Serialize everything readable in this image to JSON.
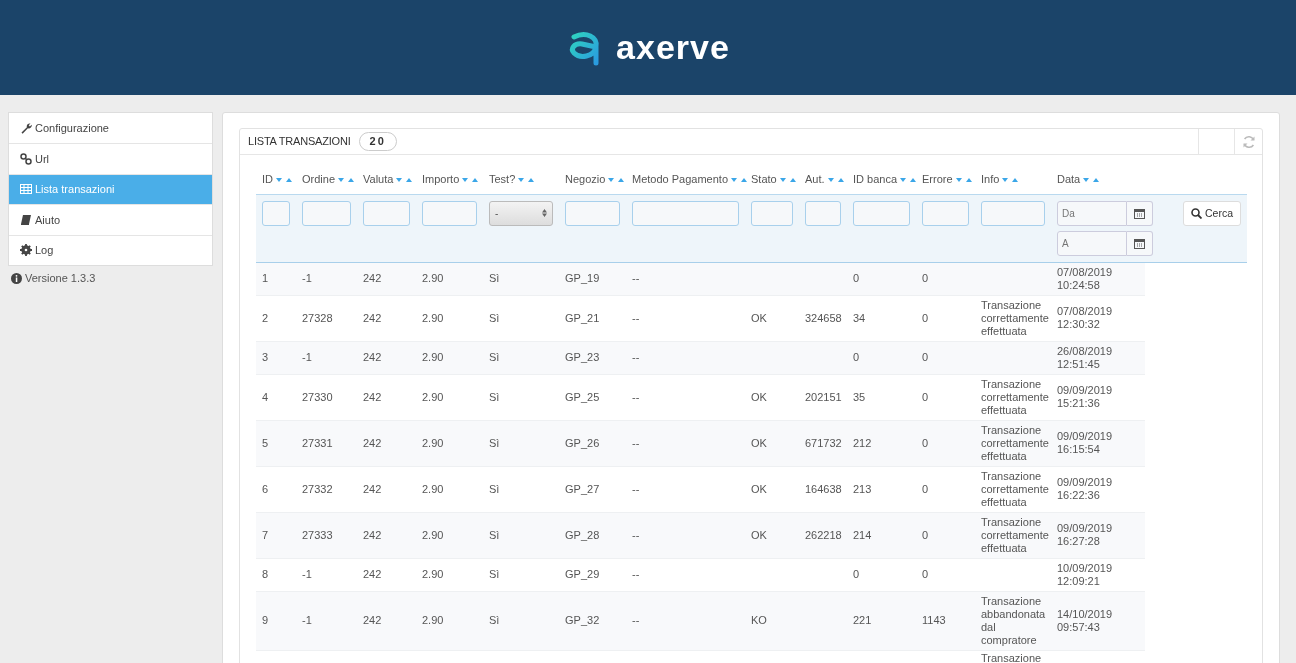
{
  "header": {
    "logo_text": "axerve"
  },
  "sidebar": {
    "items": [
      {
        "label": "Configurazione",
        "selected": false
      },
      {
        "label": "Url",
        "selected": false
      },
      {
        "label": "Lista transazioni",
        "selected": true
      },
      {
        "label": "Aiuto",
        "selected": false
      },
      {
        "label": "Log",
        "selected": false
      }
    ],
    "version": "Versione 1.3.3"
  },
  "panel": {
    "title": "LISTA TRANSAZIONI",
    "count": "20"
  },
  "table": {
    "columns": [
      "ID",
      "Ordine",
      "Valuta",
      "Importo",
      "Test?",
      "Negozio",
      "Metodo Pagamento",
      "Stato",
      "Aut.",
      "ID banca",
      "Errore",
      "Info",
      "Data"
    ],
    "filters": [
      {
        "kind": "input"
      },
      {
        "kind": "input"
      },
      {
        "kind": "input"
      },
      {
        "kind": "input"
      },
      {
        "kind": "select",
        "value": "-"
      },
      {
        "kind": "input"
      },
      {
        "kind": "input"
      },
      {
        "kind": "input"
      },
      {
        "kind": "input"
      },
      {
        "kind": "input"
      },
      {
        "kind": "input"
      },
      {
        "kind": "input"
      },
      {
        "kind": "date",
        "placeholders": [
          "Da",
          "A"
        ]
      }
    ],
    "search_button": "Cerca",
    "rows": [
      [
        "1",
        "-1",
        "242",
        "2.90",
        "Sì",
        "GP_19",
        "--",
        null,
        null,
        "0",
        "0",
        null,
        "07/08/2019 10:24:58"
      ],
      [
        "2",
        "27328",
        "242",
        "2.90",
        "Sì",
        "GP_21",
        "--",
        "OK",
        "324658",
        "34",
        "0",
        "Transazione correttamente effettuata",
        "07/08/2019 12:30:32"
      ],
      [
        "3",
        "-1",
        "242",
        "2.90",
        "Sì",
        "GP_23",
        "--",
        null,
        null,
        "0",
        "0",
        null,
        "26/08/2019 12:51:45"
      ],
      [
        "4",
        "27330",
        "242",
        "2.90",
        "Sì",
        "GP_25",
        "--",
        "OK",
        "202151",
        "35",
        "0",
        "Transazione correttamente effettuata",
        "09/09/2019 15:21:36"
      ],
      [
        "5",
        "27331",
        "242",
        "2.90",
        "Sì",
        "GP_26",
        "--",
        "OK",
        "671732",
        "212",
        "0",
        "Transazione correttamente effettuata",
        "09/09/2019 16:15:54"
      ],
      [
        "6",
        "27332",
        "242",
        "2.90",
        "Sì",
        "GP_27",
        "--",
        "OK",
        "164638",
        "213",
        "0",
        "Transazione correttamente effettuata",
        "09/09/2019 16:22:36"
      ],
      [
        "7",
        "27333",
        "242",
        "2.90",
        "Sì",
        "GP_28",
        "--",
        "OK",
        "262218",
        "214",
        "0",
        "Transazione correttamente effettuata",
        "09/09/2019 16:27:28"
      ],
      [
        "8",
        "-1",
        "242",
        "2.90",
        "Sì",
        "GP_29",
        "--",
        null,
        null,
        "0",
        "0",
        null,
        "10/09/2019 12:09:21"
      ],
      [
        "9",
        "-1",
        "242",
        "2.90",
        "Sì",
        "GP_32",
        "--",
        "KO",
        null,
        "221",
        "1143",
        "Transazione abbandonata dal compratore",
        "14/10/2019 09:57:43"
      ],
      [
        null,
        null,
        null,
        null,
        null,
        null,
        null,
        null,
        null,
        null,
        null,
        "Transazione",
        null
      ]
    ]
  }
}
